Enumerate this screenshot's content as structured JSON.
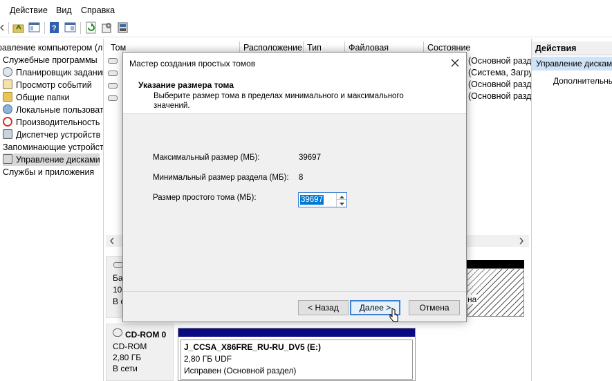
{
  "menubar": {
    "items": [
      "Действие",
      "Вид",
      "Справка"
    ]
  },
  "tree": {
    "root": "равление компьютером (л",
    "items": [
      {
        "label": "Служебные программы",
        "icon": "tools-icon"
      },
      {
        "label": "Планировщик заданий",
        "icon": "clock-icon"
      },
      {
        "label": "Просмотр событий",
        "icon": "event-viewer-icon"
      },
      {
        "label": "Общие папки",
        "icon": "shared-folder-icon"
      },
      {
        "label": "Локальные пользовате",
        "icon": "users-icon"
      },
      {
        "label": "Производительность",
        "icon": "performance-icon"
      },
      {
        "label": "Диспетчер устройств",
        "icon": "device-manager-icon"
      },
      {
        "label": "Запоминающие устройст",
        "icon": "storage-icon"
      },
      {
        "label": "Управление дисками",
        "icon": "disk-management-icon"
      },
      {
        "label": "Службы и приложения",
        "icon": "services-icon"
      }
    ]
  },
  "volume_list": {
    "columns": [
      "Том",
      "Расположение",
      "Тип",
      "Файловая система",
      "Состояние"
    ],
    "rows": [
      {
        "status": "(Основной разд"
      },
      {
        "status": "(Система, Загру"
      },
      {
        "status": "(Основной разд"
      },
      {
        "status": "(Основной разд"
      }
    ]
  },
  "disk_area": {
    "disk0": {
      "l1": "Ба",
      "l2": "10",
      "l3": "В се"
    },
    "partition_fragment": "на",
    "cdrom": {
      "name": "CD-ROM 0",
      "type": "CD-ROM",
      "size": "2,80 ГБ",
      "status": "В сети",
      "volume_label": "J_CCSA_X86FRE_RU-RU_DV5  (E:)",
      "volume_size": "2,80 ГБ UDF",
      "volume_status": "Исправен (Основной раздел)"
    }
  },
  "actions": {
    "header": "Действия",
    "selected": "Управление дискам",
    "more": "Дополнительны"
  },
  "dialog": {
    "title": "Мастер создания простых томов",
    "heading": "Указание размера тома",
    "subheading": "Выберите размер тома в пределах минимального и максимального значений.",
    "max_label": "Максимальный размер (МБ):",
    "max_value": "39697",
    "min_label": "Минимальный размер раздела (МБ):",
    "min_value": "8",
    "size_label": "Размер простого тома (МБ):",
    "size_value": "39697",
    "back_button": "< Назад",
    "next_button": "Далее >",
    "cancel_button": "Отмена"
  },
  "colors": {
    "accent": "#3c7fd3",
    "selection": "#cce8ff",
    "volume_bar": "#0a0a82",
    "black_bar": "#000000"
  }
}
